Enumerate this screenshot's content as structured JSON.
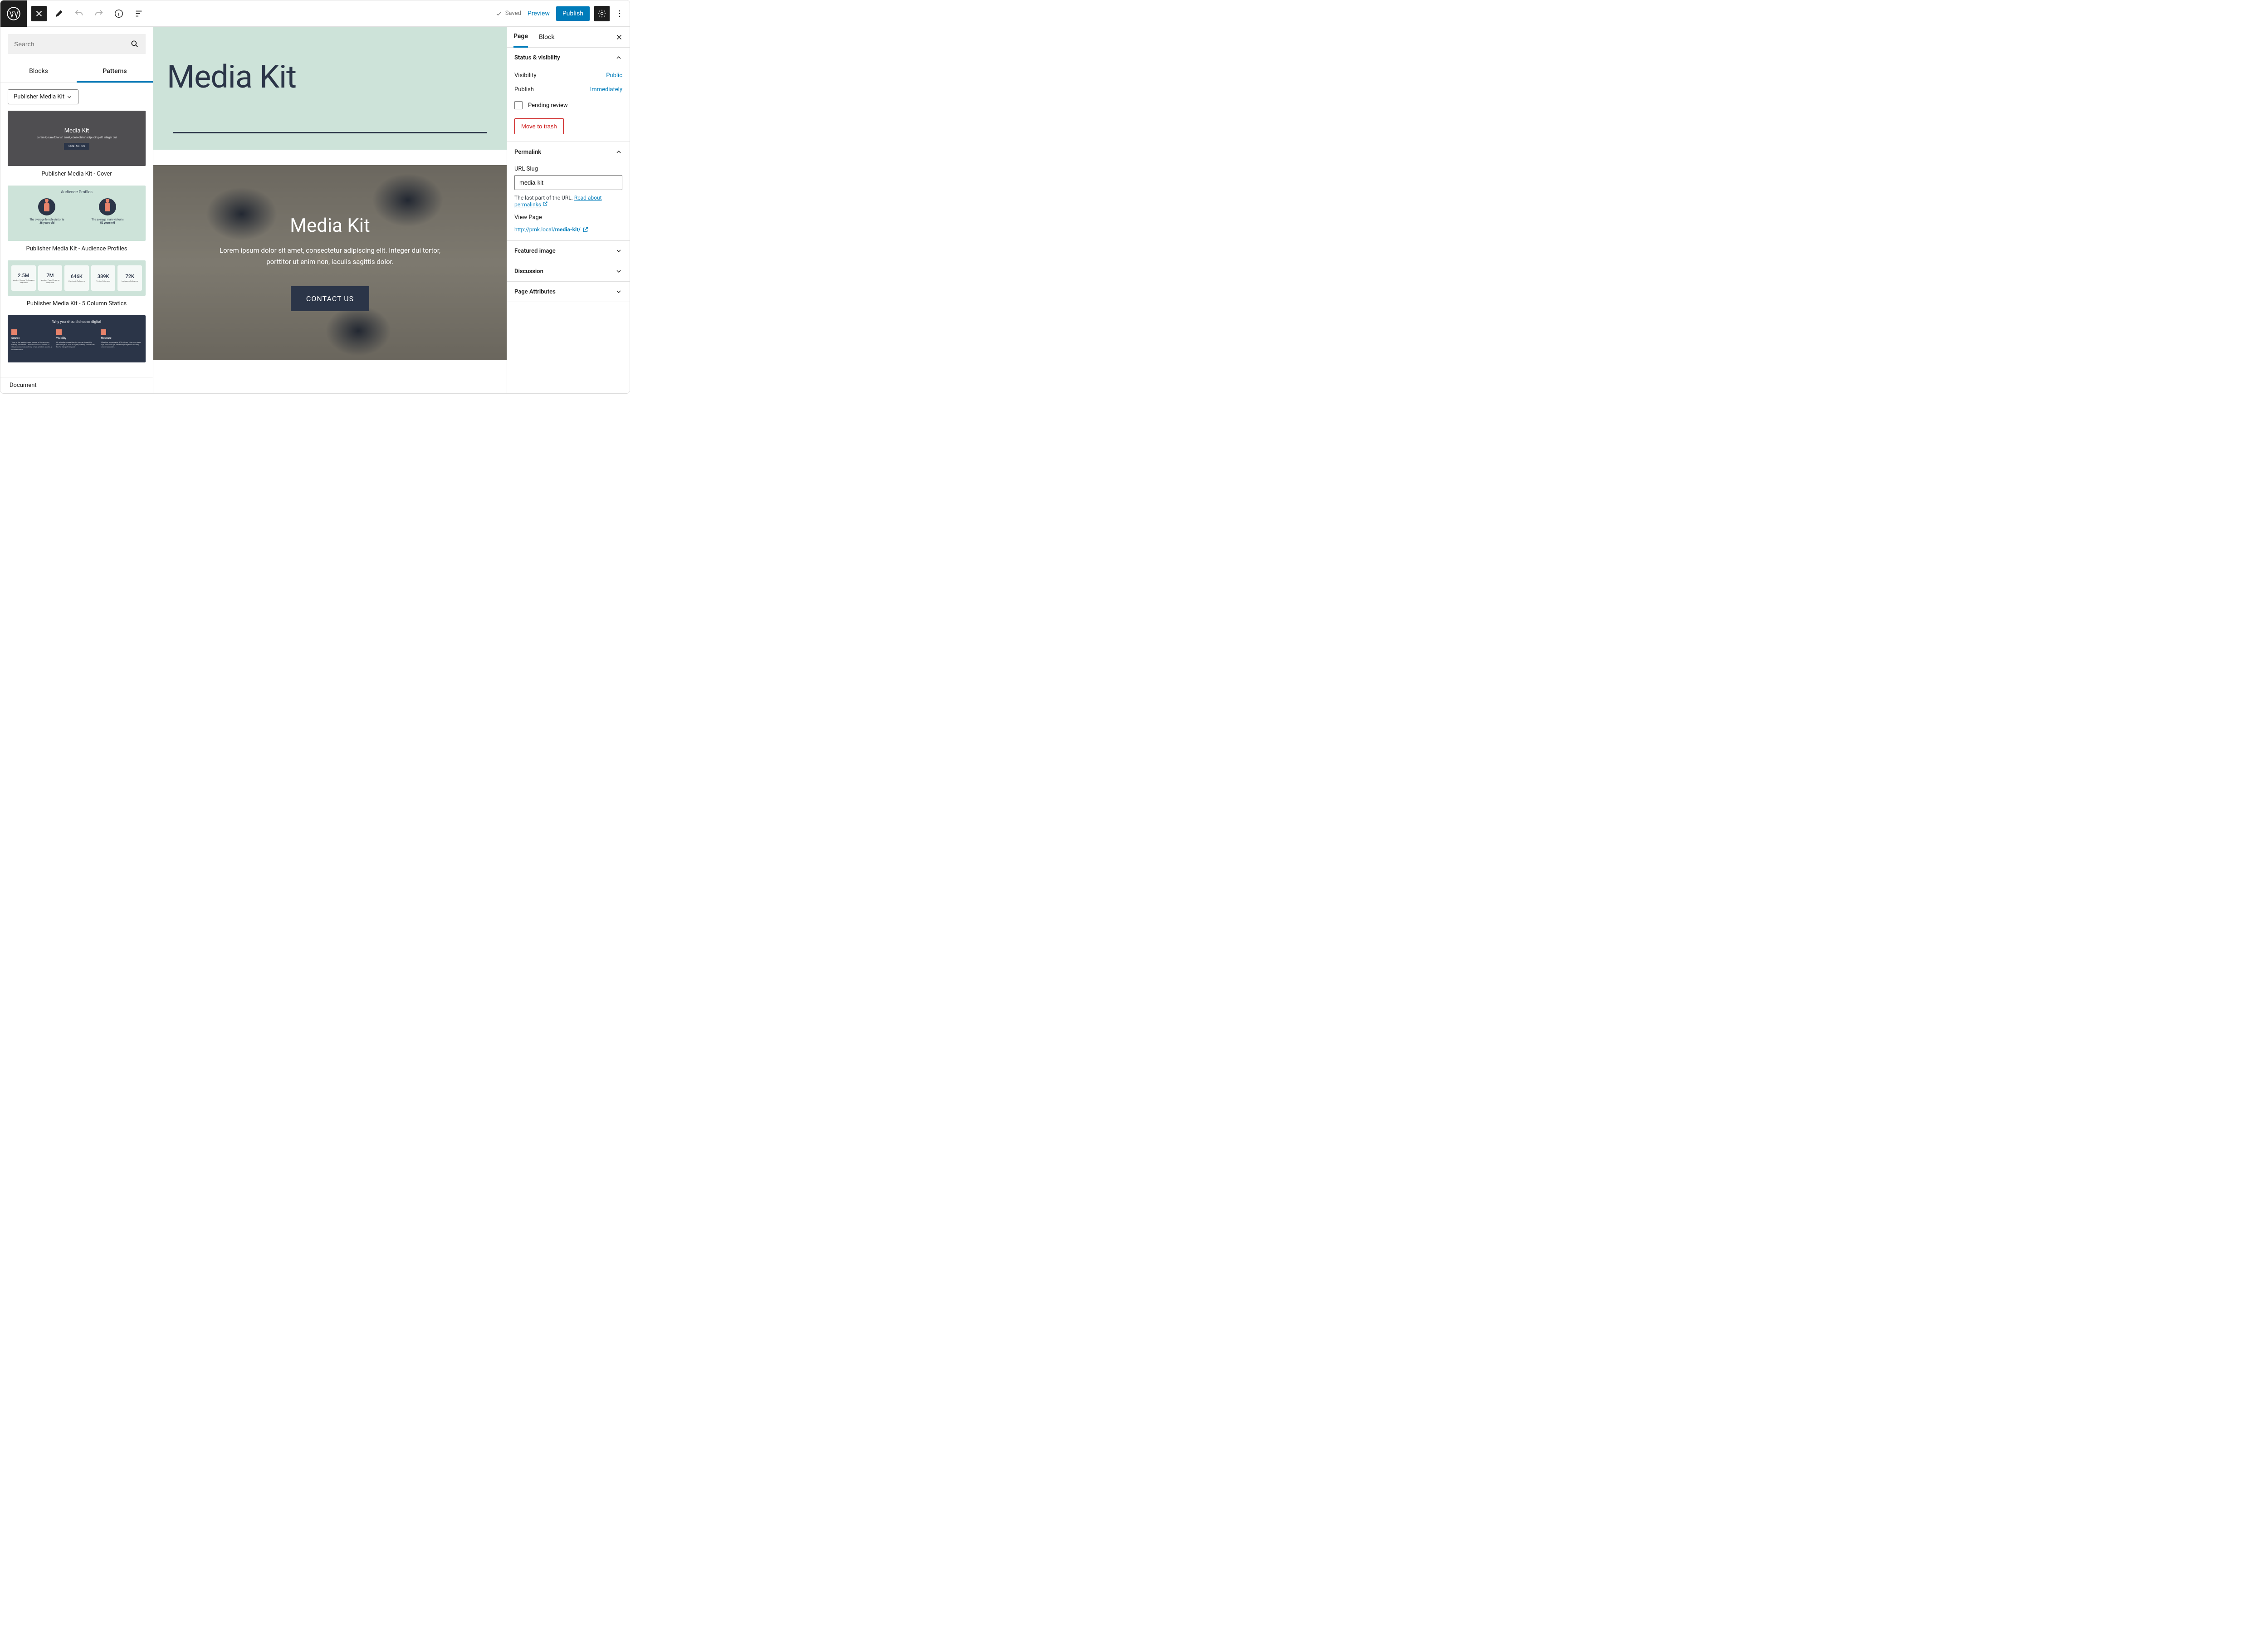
{
  "topbar": {
    "saved": "Saved",
    "preview": "Preview",
    "publish": "Publish"
  },
  "inserter": {
    "search_placeholder": "Search",
    "tab_blocks": "Blocks",
    "tab_patterns": "Patterns",
    "category": "Publisher Media Kit",
    "patterns": [
      {
        "caption": "Publisher Media Kit - Cover",
        "title": "Media Kit",
        "desc": "Lorem ipsum dolor sit amet, consectetur adipiscing elit integer dui",
        "button": "CONTACT US"
      },
      {
        "caption": "Publisher Media Kit - Audience Profiles",
        "title": "Audience Profiles",
        "left_line1": "The average female visitor is",
        "left_line2": "38 years old",
        "right_line1": "The average male visitor is",
        "right_line2": "52 years old"
      },
      {
        "caption": "Publisher Media Kit - 5 Column Statics",
        "stats": [
          {
            "num": "2.5M",
            "label": "Monthly Unique Visitors on 10up.com"
          },
          {
            "num": "7M",
            "label": "Monthly Page Views on 10up.com"
          },
          {
            "num": "646K",
            "label": "Facebook Followers"
          },
          {
            "num": "389K",
            "label": "Twitter Followers"
          },
          {
            "num": "72K",
            "label": "Instagram Followers"
          }
        ]
      },
      {
        "caption": "",
        "title": "Why you should choose digital",
        "cols": [
          {
            "h": "Source",
            "d": "10up is the leading news source in Sacramento making it Northern California's GO-TO choice to stay informed on anything news, weather, sports & entertainment."
          },
          {
            "h": "Visibility",
            "d": "All ad units across the site have a viewability percentage of 70% of higher, making \"above-the-fold\" a thing of the past!"
          },
          {
            "h": "Measure",
            "d": "10up has Measurable ROI! Ads on 10up.com have high click-through percentages against industry benchmark rates."
          }
        ]
      }
    ],
    "footer": "Document"
  },
  "canvas": {
    "header_title": "Media Kit",
    "cover_title": "Media Kit",
    "cover_desc": "Lorem ipsum dolor sit amet, consectetur adipiscing elit. Integer dui tortor, porttitor ut enim non, iaculis sagittis dolor.",
    "cover_button": "CONTACT US"
  },
  "sidebar": {
    "tab_page": "Page",
    "tab_block": "Block",
    "sections": {
      "status": {
        "title": "Status & visibility",
        "visibility_label": "Visibility",
        "visibility_value": "Public",
        "publish_label": "Publish",
        "publish_value": "Immediately",
        "pending": "Pending review",
        "trash": "Move to trash"
      },
      "permalink": {
        "title": "Permalink",
        "slug_label": "URL Slug",
        "slug_value": "media-kit",
        "help_prefix": "The last part of the URL. ",
        "help_link": "Read about permalinks",
        "view_page": "View Page",
        "url_base": "http://pmk.local/",
        "url_slug": "media-kit/"
      },
      "featured": {
        "title": "Featured image"
      },
      "discussion": {
        "title": "Discussion"
      },
      "attrs": {
        "title": "Page Attributes"
      }
    }
  }
}
